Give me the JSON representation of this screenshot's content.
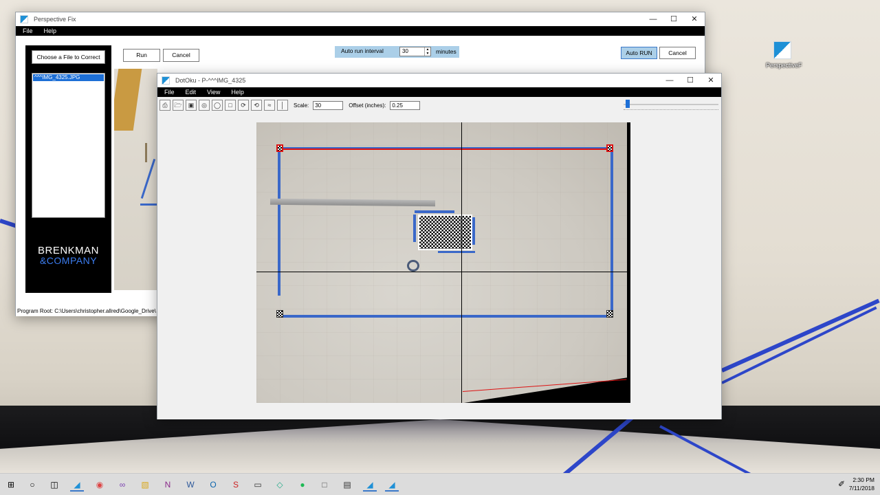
{
  "desktop": {
    "icon_label": "PerspectiveF"
  },
  "perspective_fix": {
    "title": "Perspective Fix",
    "menu": [
      "File",
      "Help"
    ],
    "choose_button": "Choose a File to Correct",
    "run_button": "Run",
    "cancel_button": "Cancel",
    "auto_run_interval_label": "Auto run interval",
    "auto_run_interval_value": "30",
    "minutes_label": "minutes",
    "auto_run_button": "Auto RUN",
    "auto_cancel_button": "Cancel",
    "files": [
      "^^^IMG_4325.JPG"
    ],
    "logo_line1": "BRENKMAN",
    "logo_line2": "&COMPANY",
    "status": "Program Root: C:\\Users\\christopher.allred\\Google_Drive\\"
  },
  "dotoku": {
    "title": "DotOku - P-^^^IMG_4325",
    "menu": [
      "File",
      "Edit",
      "View",
      "Help"
    ],
    "scale_label": "Scale:",
    "scale_value": "30",
    "offset_label": "Offset (inches):",
    "offset_value": "0.25",
    "zoom_level": 0.02
  },
  "taskbar": {
    "time": "2:30 PM",
    "date": "7/11/2018"
  },
  "colors": {
    "accent": "#1e90d6",
    "selection": "#1d6fd6",
    "tape_blue": "#3a68c9",
    "marker_red": "#dd1111",
    "auto_run_bg": "#abcfe8"
  }
}
